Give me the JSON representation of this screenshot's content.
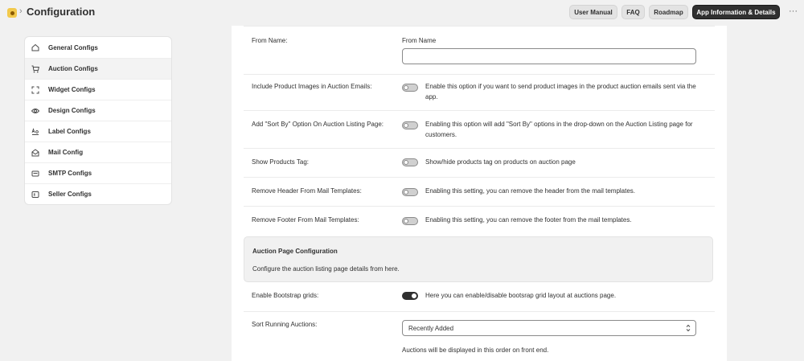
{
  "header": {
    "app_icon": "app-icon",
    "separator": "›",
    "title": "Configuration",
    "buttons": {
      "user_manual": "User Manual",
      "faq": "FAQ",
      "roadmap": "Roadmap",
      "app_info": "App Information & Details"
    },
    "more": "···"
  },
  "sidebar": {
    "items": [
      {
        "label": "General Configs",
        "icon": "home-icon"
      },
      {
        "label": "Auction Configs",
        "icon": "cart-icon"
      },
      {
        "label": "Widget Configs",
        "icon": "frame-icon"
      },
      {
        "label": "Design Configs",
        "icon": "eye-icon"
      },
      {
        "label": "Label Configs",
        "icon": "label-icon"
      },
      {
        "label": "Mail Config",
        "icon": "mail-open-icon"
      },
      {
        "label": "SMTP Configs",
        "icon": "envelope-icon"
      },
      {
        "label": "Seller Configs",
        "icon": "seller-icon"
      }
    ],
    "active_index": 1
  },
  "settings": {
    "from_name": {
      "label": "From Name:",
      "field_title": "From Name",
      "value": "",
      "placeholder": ""
    },
    "product_images": {
      "label": "Include Product Images in Auction Emails:",
      "description": "Enable this option if you want to send product images in the product auction emails sent via the app.",
      "enabled": false
    },
    "sort_by": {
      "label": "Add \"Sort By\" Option On Auction Listing Page:",
      "description": "Enabling this option will add \"Sort By\" options in the drop-down on the Auction Listing page for customers.",
      "enabled": false
    },
    "products_tag": {
      "label": "Show Products Tag:",
      "description": "Show/hide products tag on products on auction page",
      "enabled": false
    },
    "remove_header": {
      "label": "Remove Header From Mail Templates:",
      "description": "Enabling this setting, you can remove the header from the mail templates.",
      "enabled": false
    },
    "remove_footer": {
      "label": "Remove Footer From Mail Templates:",
      "description": "Enabling this setting, you can remove the footer from the mail templates.",
      "enabled": false
    }
  },
  "auction_page": {
    "title": "Auction Page Configuration",
    "subtitle": "Configure the auction listing page details from here.",
    "bootstrap": {
      "label": "Enable Bootstrap grids:",
      "description": "Here you can enable/disable bootsrap grid layout at auctions page.",
      "enabled": true
    },
    "sort_running": {
      "label": "Sort Running Auctions:",
      "selected": "Recently Added",
      "helper": "Auctions will be displayed in this order on front end."
    }
  },
  "colors": {
    "background": "#f1f1f1",
    "primary_button": "#303030",
    "toggle_on": "#303030",
    "toggle_off": "#d0d0d0"
  }
}
